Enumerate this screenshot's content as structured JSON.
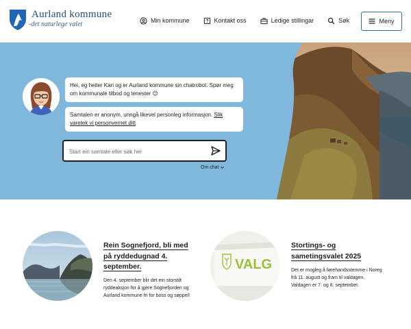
{
  "header": {
    "logo_name": "Aurland kommune",
    "logo_tagline": "-det naturlege valet",
    "nav": [
      {
        "label": "Min kommune",
        "icon": "user-circle-icon"
      },
      {
        "label": "Kontakt oss",
        "icon": "question-box-icon"
      },
      {
        "label": "Ledige stillingar",
        "icon": "briefcase-icon"
      },
      {
        "label": "Søk",
        "icon": "search-icon"
      }
    ],
    "menu_label": "Meny"
  },
  "chat": {
    "greeting": "Hei, eg heiter Kari og er Aurland kommune sin chatrobot. Spør meg om kommunale tilbod og tenester 😊",
    "privacy_text": "Samtalen er anonym, unngå likevel personleg informasjon.",
    "privacy_link": "Slik varetek vi personvernet ditt",
    "input_placeholder": "Start ein samtale eller søk her",
    "about_label": "Om chat"
  },
  "news": [
    {
      "title": "Rein Sognefjord, bli med på ryddedugnad 4. september.",
      "text": "Den 4. september blir det ein storstilt ryddeaksjon for å gjere Sognefjorden og Aurland kommune fri for boss og søppel!"
    },
    {
      "title": "Stortings- og sametingsvalet 2025",
      "text": "Det er mogleg å førehandsstemme i Noreg frå 11. august og fram til valdagen. Valdagen er 7. og 8. september.",
      "image_text": "VALG"
    }
  ],
  "colors": {
    "hero_bg": "#7fb8dc",
    "brand_blue": "#244a7a",
    "menu_border": "#2f6f8f"
  }
}
